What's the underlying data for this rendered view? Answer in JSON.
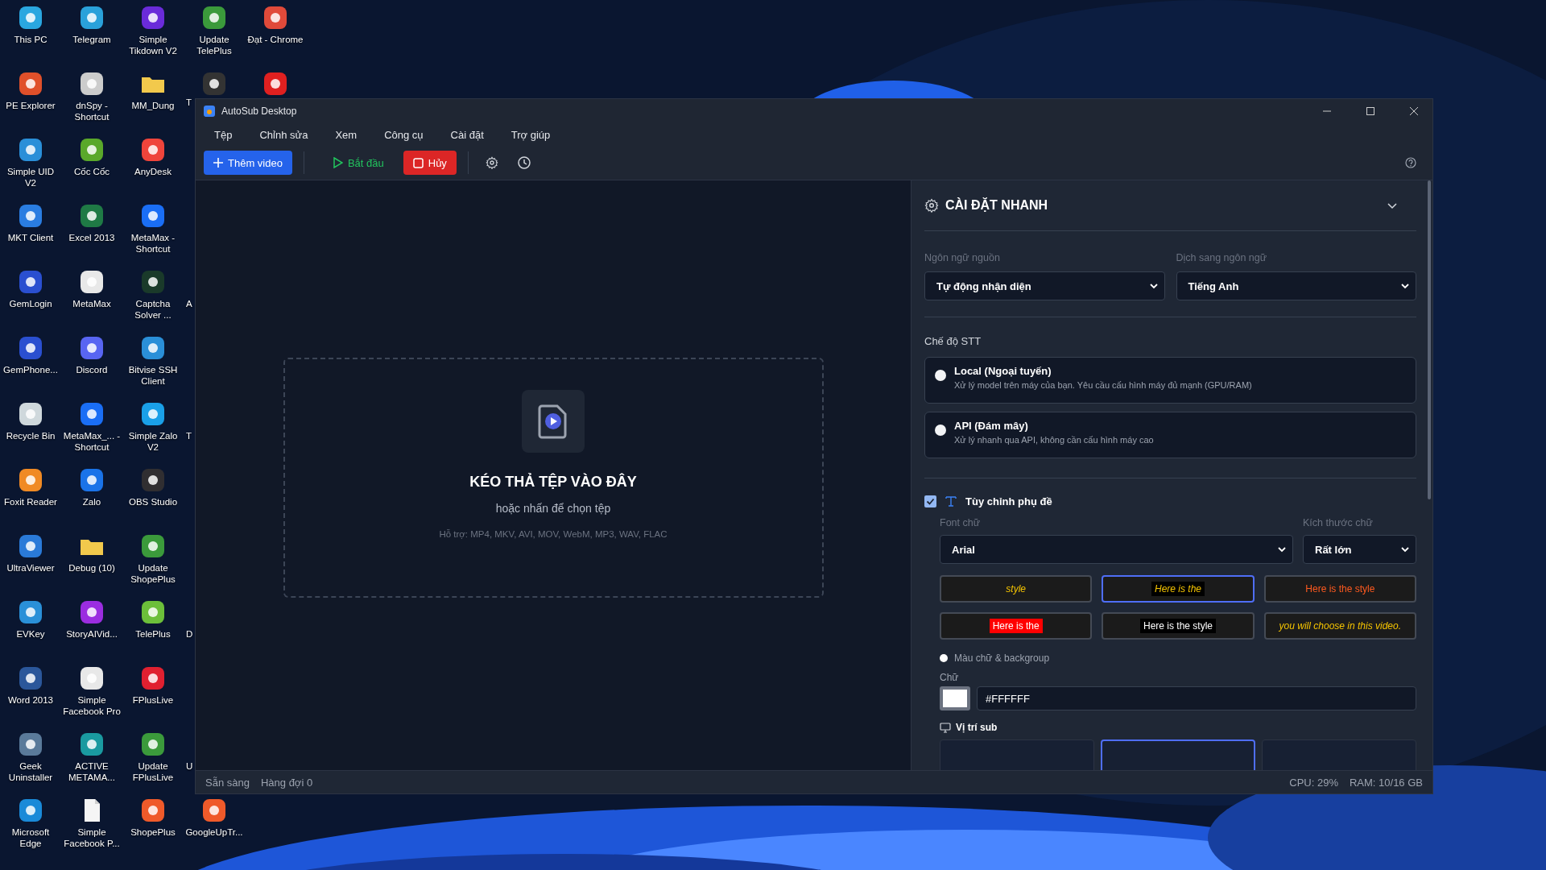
{
  "desktop": {
    "columns": [
      [
        {
          "kind": "app",
          "label": "This PC",
          "color": "#2aa7e0"
        },
        {
          "kind": "app",
          "label": "PE Explorer",
          "color": "#e0502a"
        },
        {
          "kind": "app",
          "label": "Simple UID V2",
          "color": "#2a8fd8"
        },
        {
          "kind": "app",
          "label": "MKT Client",
          "color": "#2a7de1"
        },
        {
          "kind": "app",
          "label": "GemLogin",
          "color": "#2a4fd0"
        },
        {
          "kind": "app",
          "label": "GemPhone...",
          "color": "#2a4fd0"
        },
        {
          "kind": "app",
          "label": "Recycle Bin",
          "color": "#cfd8dc"
        },
        {
          "kind": "app",
          "label": "Foxit Reader",
          "color": "#f08a24"
        },
        {
          "kind": "app",
          "label": "UltraViewer",
          "color": "#2a7ad8"
        },
        {
          "kind": "app",
          "label": "EVKey",
          "color": "#2a90d8"
        },
        {
          "kind": "app",
          "label": "Word 2013",
          "color": "#2b579a"
        },
        {
          "kind": "app",
          "label": "Geek Uninstaller",
          "color": "#5a7a9a"
        },
        {
          "kind": "app",
          "label": "Microsoft Edge",
          "color": "#1a8ad8"
        }
      ],
      [
        {
          "kind": "app",
          "label": "Telegram",
          "color": "#2aa1da"
        },
        {
          "kind": "app",
          "label": "dnSpy - Shortcut",
          "color": "#cccccc"
        },
        {
          "kind": "app",
          "label": "Cốc Cốc",
          "color": "#5aa82a"
        },
        {
          "kind": "app",
          "label": "Excel 2013",
          "color": "#1f7a45"
        },
        {
          "kind": "app",
          "label": "MetaMax",
          "color": "#e8e8e8"
        },
        {
          "kind": "app",
          "label": "Discord",
          "color": "#5865f2"
        },
        {
          "kind": "app",
          "label": "MetaMax_... - Shortcut",
          "color": "#1a6ef5"
        },
        {
          "kind": "app",
          "label": "Zalo",
          "color": "#1a73e8"
        },
        {
          "kind": "folder",
          "label": "Debug (10)",
          "color": "#f2c94c"
        },
        {
          "kind": "app",
          "label": "StoryAIVid...",
          "color": "#9b2de0"
        },
        {
          "kind": "app",
          "label": "Simple Facebook Pro",
          "color": "#e8e8e8"
        },
        {
          "kind": "app",
          "label": "ACTIVE METAMA...",
          "color": "#1a9aa0"
        },
        {
          "kind": "file",
          "label": "Simple Facebook P...",
          "color": "#f5f5f5"
        }
      ],
      [
        {
          "kind": "app",
          "label": "Simple Tikdown V2",
          "color": "#6a2bd9"
        },
        {
          "kind": "folder",
          "label": "MM_Dung",
          "color": "#f2c94c"
        },
        {
          "kind": "app",
          "label": "AnyDesk",
          "color": "#ef443b"
        },
        {
          "kind": "app",
          "label": "MetaMax - Shortcut",
          "color": "#1a6ef5"
        },
        {
          "kind": "app",
          "label": "Captcha Solver ...",
          "color": "#1a3a2a"
        },
        {
          "kind": "app",
          "label": "Bitvise SSH Client",
          "color": "#2a8fd8"
        },
        {
          "kind": "app",
          "label": "Simple Zalo V2",
          "color": "#1aa0e8"
        },
        {
          "kind": "app",
          "label": "OBS Studio",
          "color": "#302e31"
        },
        {
          "kind": "app",
          "label": "Update ShopePlus",
          "color": "#3b9a3b"
        },
        {
          "kind": "app",
          "label": "TelePlus",
          "color": "#6cbf3a"
        },
        {
          "kind": "app",
          "label": "FPlusLive",
          "color": "#e02030"
        },
        {
          "kind": "app",
          "label": "Update FPlusLive",
          "color": "#3b9a3b"
        },
        {
          "kind": "app",
          "label": "ShopePlus",
          "color": "#ef5a2a"
        }
      ],
      [
        {
          "kind": "app",
          "label": "Update TelePlus",
          "color": "#3b9a3b"
        },
        {
          "kind": "app-cut",
          "label": "T",
          "color": "#333333"
        },
        {
          "kind": "empty"
        },
        {
          "kind": "empty"
        },
        {
          "kind": "fragment",
          "label": "A"
        },
        {
          "kind": "empty"
        },
        {
          "kind": "fragment",
          "label": "T"
        },
        {
          "kind": "empty"
        },
        {
          "kind": "empty"
        },
        {
          "kind": "fragment",
          "label": "D"
        },
        {
          "kind": "empty"
        },
        {
          "kind": "fragment",
          "label": "U"
        },
        {
          "kind": "app",
          "label": "GoogleUpTr...",
          "color": "#ef5a2a"
        }
      ],
      [
        {
          "kind": "app",
          "label": "Đạt - Chrome",
          "color": "#e04a3a"
        },
        {
          "kind": "app",
          "color": "#e02020"
        }
      ]
    ]
  },
  "window": {
    "title": "AutoSub Desktop",
    "menu": [
      "Tệp",
      "Chỉnh sửa",
      "Xem",
      "Công cụ",
      "Cài đặt",
      "Trợ giúp"
    ],
    "toolbar": {
      "add": "Thêm video",
      "start": "Bắt đầu",
      "cancel": "Hủy"
    },
    "dropzone": {
      "title": "KÉO THẢ TỆP VÀO ĐÂY",
      "subtitle": "hoặc nhấn để chọn tệp",
      "formats": "Hỗ trợ: MP4, MKV, AVI, MOV, WebM, MP3, WAV, FLAC"
    },
    "quick_settings": {
      "title": "CÀI ĐẶT NHANH",
      "expanded": true,
      "source_label": "Ngôn ngữ nguồn",
      "source_value": "Tự động nhận diện",
      "target_label": "Dịch sang ngôn ngữ",
      "target_value": "Tiếng Anh",
      "stt_label": "Chế độ STT",
      "stt_modes": [
        {
          "title": "Local (Ngoại tuyến)",
          "description": "Xử lý model trên máy của bạn. Yêu cầu cấu hình máy đủ mạnh (GPU/RAM)",
          "selected": false
        },
        {
          "title": "API (Đám mây)",
          "description": "Xử lý nhanh qua API, không cần cấu hình máy cao",
          "selected": false
        }
      ],
      "custom_subtitle": {
        "label": "Tùy chỉnh phụ đề",
        "checked": true,
        "font_label": "Font chữ",
        "font_value": "Arial",
        "size_label": "Kích thước chữ",
        "size_value": "Rất lớn",
        "presets": [
          {
            "text": "style",
            "kind": "italic",
            "color": "#f5c400",
            "selected": false
          },
          {
            "text": "Here is the",
            "kind": "italic-boxed",
            "color": "#f5c400",
            "selected": true
          },
          {
            "text": "Here is the style",
            "kind": "plain",
            "color": "#ff5a1f",
            "selected": false
          },
          {
            "text": "Here is the",
            "kind": "red-box",
            "color": "#ffffff",
            "selected": false
          },
          {
            "text": "Here is the style",
            "kind": "boxed",
            "color": "#ffffff",
            "selected": false
          },
          {
            "text": "you will choose in this video.",
            "kind": "italic",
            "color": "#f5c400",
            "selected": false
          }
        ],
        "color_mode": {
          "label": "Màu chữ & backgroup",
          "selected": false
        },
        "text_color_label": "Chữ",
        "text_color": {
          "color": "#ffffff",
          "value": "#FFFFFF"
        },
        "position_label": "Vị trí sub",
        "positions": [
          {
            "selected": false
          },
          {
            "selected": true
          },
          {
            "selected": false
          }
        ]
      }
    },
    "status_bar": {
      "state": "Sẵn sàng",
      "queue": "Hàng đợi 0",
      "cpu": "CPU: 29%",
      "ram": "RAM: 10/16 GB"
    }
  }
}
